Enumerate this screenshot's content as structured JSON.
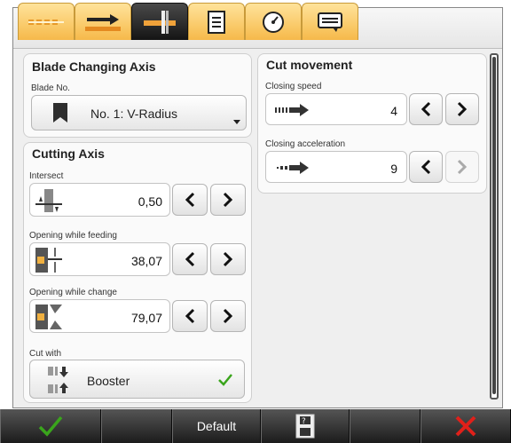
{
  "tabs": [
    {
      "name": "tab-overview",
      "icon": "dashed-bars-icon"
    },
    {
      "name": "tab-feed",
      "icon": "feed-arrow-icon"
    },
    {
      "name": "tab-cut",
      "icon": "blade-cut-icon",
      "active": true
    },
    {
      "name": "tab-list",
      "icon": "list-icon"
    },
    {
      "name": "tab-gauge",
      "icon": "gauge-icon"
    },
    {
      "name": "tab-message",
      "icon": "message-icon"
    }
  ],
  "blade_axis": {
    "title": "Blade Changing Axis",
    "blade_no_label": "Blade No.",
    "blade_value": "No. 1: V-Radius"
  },
  "cutting_axis": {
    "title": "Cutting Axis",
    "intersect_label": "Intersect",
    "intersect_value": "0,50",
    "opening_feeding_label": "Opening while feeding",
    "opening_feeding_value": "38,07",
    "opening_change_label": "Opening while change",
    "opening_change_value": "79,07",
    "cut_with_label": "Cut with",
    "cut_with_value": "Booster"
  },
  "cut_movement": {
    "title": "Cut movement",
    "closing_speed_label": "Closing speed",
    "closing_speed_value": "4",
    "closing_accel_label": "Closing acceleration",
    "closing_accel_value": "9"
  },
  "bottom": {
    "default_label": "Default"
  },
  "colors": {
    "tab_gold": "#f6b94a",
    "confirm_green": "#3aa51c",
    "cancel_red": "#e0201a"
  }
}
